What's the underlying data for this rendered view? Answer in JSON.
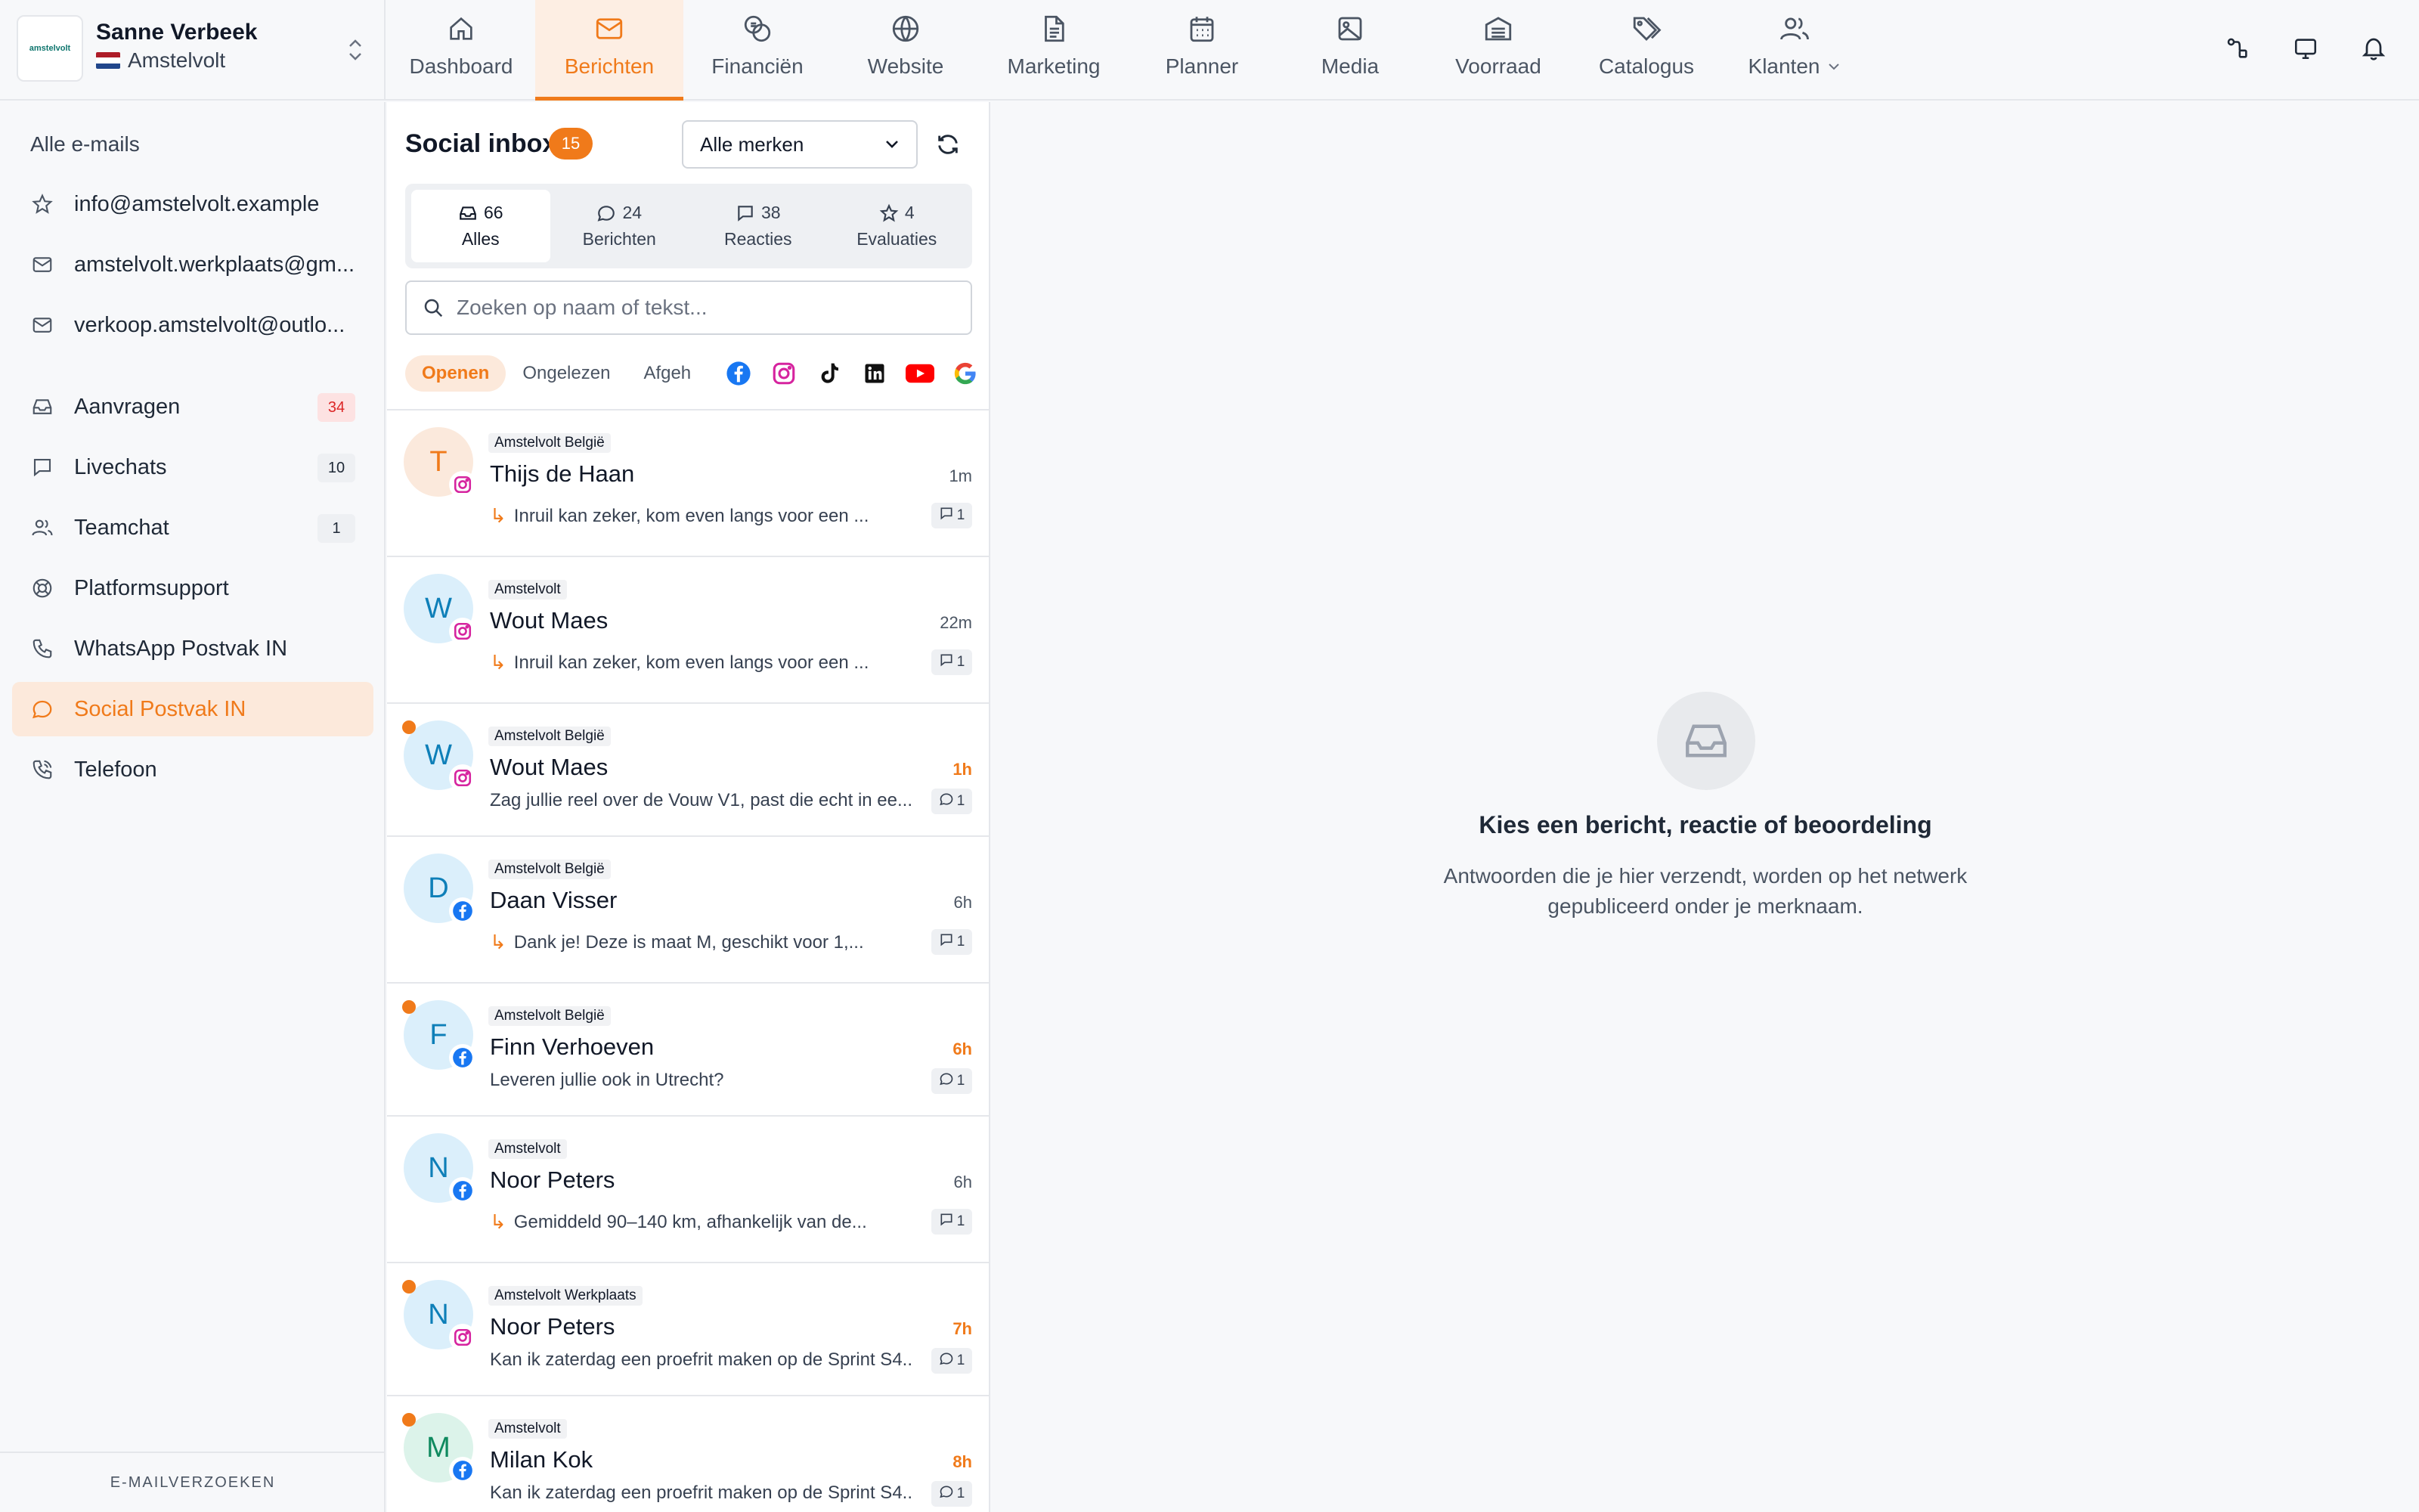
{
  "account": {
    "logo_text": "amstelvolt",
    "name": "Sanne Verbeek",
    "org": "Amstelvolt"
  },
  "nav": {
    "items": [
      {
        "label": "Dashboard",
        "icon": "home-icon"
      },
      {
        "label": "Berichten",
        "icon": "mail-icon",
        "active": true
      },
      {
        "label": "Financiën",
        "icon": "coins-icon"
      },
      {
        "label": "Website",
        "icon": "globe-icon"
      },
      {
        "label": "Marketing",
        "icon": "document-icon"
      },
      {
        "label": "Planner",
        "icon": "calendar-icon"
      },
      {
        "label": "Media",
        "icon": "image-icon"
      },
      {
        "label": "Voorraad",
        "icon": "warehouse-icon"
      },
      {
        "label": "Catalogus",
        "icon": "tags-icon"
      },
      {
        "label": "Klanten",
        "icon": "users-icon"
      }
    ]
  },
  "sidebar": {
    "heading": "Alle e-mails",
    "mailboxes": [
      {
        "label": "info@amstelvolt.example",
        "icon": "star-icon"
      },
      {
        "label": "amstelvolt.werkplaats@gm...",
        "icon": "mail-icon"
      },
      {
        "label": "verkoop.amstelvolt@outlo...",
        "icon": "mail-icon"
      }
    ],
    "channels": [
      {
        "label": "Aanvragen",
        "badge": "34",
        "icon": "inbox-icon"
      },
      {
        "label": "Livechats",
        "badge": "10",
        "icon": "chat-icon"
      },
      {
        "label": "Teamchat",
        "badge": "1",
        "icon": "team-icon"
      },
      {
        "label": "Platformsupport",
        "badge": "",
        "icon": "lifebuoy-icon"
      },
      {
        "label": "WhatsApp Postvak IN",
        "badge": "",
        "icon": "phone-icon"
      },
      {
        "label": "Social Postvak IN",
        "badge": "",
        "icon": "chat-bubble-icon",
        "active": true
      },
      {
        "label": "Telefoon",
        "badge": "",
        "icon": "phone-call-icon"
      }
    ],
    "footer": "E-MAILVERZOEKEN"
  },
  "inbox": {
    "title": "Social inbox",
    "count": "15",
    "brand_select": "Alle merken",
    "segments": [
      {
        "count": "66",
        "label": "Alles"
      },
      {
        "count": "24",
        "label": "Berichten"
      },
      {
        "count": "38",
        "label": "Reacties"
      },
      {
        "count": "4",
        "label": "Evaluaties"
      }
    ],
    "search_placeholder": "Zoeken op naam of tekst...",
    "filters": [
      "Openen",
      "Ongelezen",
      "Afgeh"
    ],
    "networks": [
      "facebook-icon",
      "instagram-icon",
      "tiktok-icon",
      "linkedin-icon",
      "youtube-icon",
      "google-icon"
    ],
    "items": [
      {
        "initial": "T",
        "brand": "Amstelvolt België",
        "name": "Thijs de Haan",
        "time": "1m",
        "snippet": "Inruil kan zeker, kom even langs voor een ...",
        "reply": true,
        "count": "1",
        "network": "instagram",
        "unread": false
      },
      {
        "initial": "W",
        "brand": "Amstelvolt",
        "name": "Wout Maes",
        "time": "22m",
        "snippet": "Inruil kan zeker, kom even langs voor een ...",
        "reply": true,
        "count": "1",
        "network": "instagram",
        "unread": false
      },
      {
        "initial": "W",
        "brand": "Amstelvolt België",
        "name": "Wout Maes",
        "time": "1h",
        "snippet": "Zag jullie reel over de Vouw V1, past die echt in ee...",
        "reply": false,
        "count": "1",
        "network": "instagram",
        "unread": true
      },
      {
        "initial": "D",
        "brand": "Amstelvolt België",
        "name": "Daan Visser",
        "time": "6h",
        "snippet": "Dank je! Deze is maat M, geschikt voor 1,...",
        "reply": true,
        "count": "1",
        "network": "facebook",
        "unread": false
      },
      {
        "initial": "F",
        "brand": "Amstelvolt België",
        "name": "Finn Verhoeven",
        "time": "6h",
        "snippet": "Leveren jullie ook in Utrecht?",
        "reply": false,
        "count": "1",
        "network": "facebook",
        "unread": true
      },
      {
        "initial": "N",
        "brand": "Amstelvolt",
        "name": "Noor Peters",
        "time": "6h",
        "snippet": "Gemiddeld 90–140 km, afhankelijk van de...",
        "reply": true,
        "count": "1",
        "network": "facebook",
        "unread": false
      },
      {
        "initial": "N",
        "brand": "Amstelvolt Werkplaats",
        "name": "Noor Peters",
        "time": "7h",
        "snippet": "Kan ik zaterdag een proefrit maken op de Sprint S4...",
        "reply": false,
        "count": "1",
        "network": "instagram",
        "unread": true
      },
      {
        "initial": "M",
        "brand": "Amstelvolt",
        "name": "Milan Kok",
        "time": "8h",
        "snippet": "Kan ik zaterdag een proefrit maken op de Sprint S4...",
        "reply": false,
        "count": "1",
        "network": "facebook",
        "unread": true
      }
    ]
  },
  "detail": {
    "empty_title": "Kies een bericht, reactie of beoordeling",
    "empty_subtitle": "Antwoorden die je hier verzendt, worden op het netwerk gepubliceerd onder je merknaam."
  },
  "colors": {
    "accent": "#f07a1a",
    "facebook": "#1877f2",
    "instagram": "#d6249f",
    "youtube": "#ff0000",
    "badge_red": "#dc2626"
  }
}
